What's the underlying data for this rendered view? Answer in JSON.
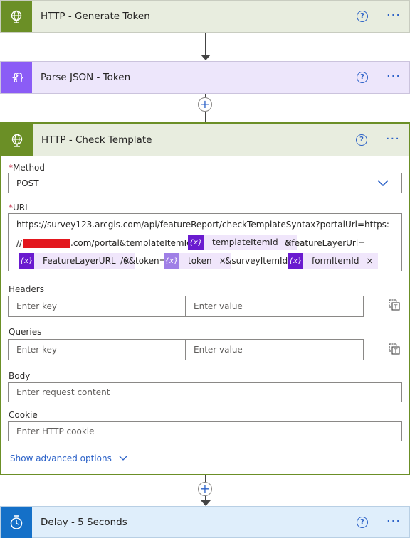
{
  "steps": [
    {
      "title": "HTTP - Generate Token",
      "icon": "globe-icon"
    },
    {
      "title": "Parse JSON - Token",
      "icon": "braces-icon"
    },
    {
      "title": "HTTP - Check Template",
      "icon": "globe-icon"
    },
    {
      "title": "Delay - 5 Seconds",
      "icon": "timer-icon"
    }
  ],
  "help_glyph": "?",
  "more_glyph": "···",
  "plus_glyph": "+",
  "form": {
    "method_label": "Method",
    "method_value": "POST",
    "uri_label": "URI",
    "required_mark": "*",
    "uri_line1": "https://survey123.arcgis.com/api/featureReport/checkTemplateSyntax?portalUrl=https:",
    "uri_line2_prefix": "//",
    "uri_line2_mid": ".com/portal&templateItemId=",
    "uri_line2_suffix": "&featureLayerUrl=",
    "uri_line3_mid": "/0&token=",
    "uri_line3_suffix": "&surveyItemId=",
    "tokens": {
      "templateItemId": "templateItemId",
      "featureLayerURL": "FeatureLayerURL",
      "token": "token",
      "formItemId": "formItemId"
    },
    "token_icon_text": "{x}",
    "token_remove": "×",
    "headers_label": "Headers",
    "queries_label": "Queries",
    "key_placeholder": "Enter key",
    "value_placeholder": "Enter value",
    "body_label": "Body",
    "body_placeholder": "Enter request content",
    "cookie_label": "Cookie",
    "cookie_placeholder": "Enter HTTP cookie",
    "advanced_link": "Show advanced options"
  },
  "colors": {
    "http_icon_bg": "#6b8f26",
    "http_header_bg": "#e8eddf",
    "parse_icon_bg": "#8b5cf6",
    "parse_header_bg": "#ede6fb",
    "delay_icon_bg": "#1470c8",
    "delay_header_bg": "#dfeefb",
    "accent": "#2c62c8",
    "redaction": "#e3171e"
  }
}
